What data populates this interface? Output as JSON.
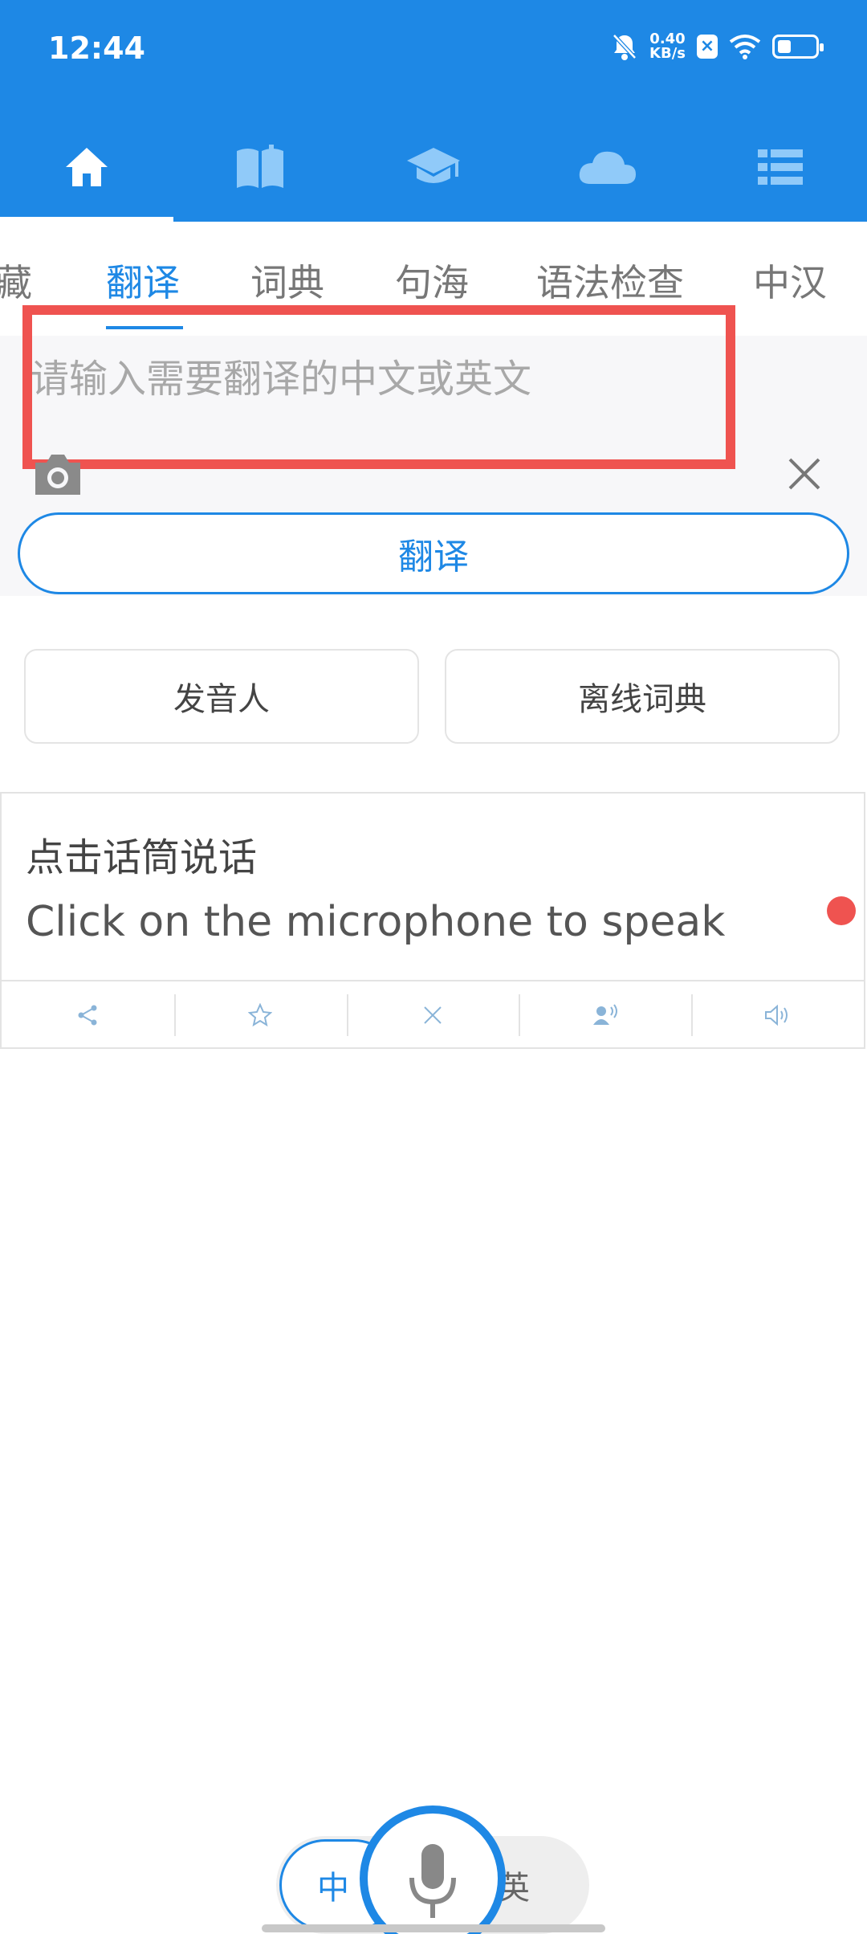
{
  "status_bar": {
    "time": "12:44",
    "speed_value": "0.40",
    "speed_unit": "KB/s"
  },
  "nav_tabs": [
    {
      "icon": "home-icon",
      "active": true
    },
    {
      "icon": "book-icon",
      "active": false
    },
    {
      "icon": "graduation-cap-icon",
      "active": false
    },
    {
      "icon": "cloud-icon",
      "active": false
    },
    {
      "icon": "list-icon",
      "active": false
    }
  ],
  "sub_tabs": [
    "藏",
    "翻译",
    "词典",
    "句海",
    "语法检查",
    "中汉"
  ],
  "active_sub_tab": "翻译",
  "input": {
    "placeholder": "请输入需要翻译的中文或英文",
    "value": ""
  },
  "translate_button": "翻译",
  "options": {
    "speaker_button": "发音人",
    "offline_dict_button": "离线词典"
  },
  "result_card": {
    "source_text": "点击话筒说话",
    "translated_text": "Click on the microphone to speak",
    "actions": [
      "share-icon",
      "star-icon",
      "close-icon",
      "voice-icon",
      "speaker-icon"
    ]
  },
  "language_switch": {
    "from": "中",
    "to": "英"
  },
  "colors": {
    "primary": "#1e88e5",
    "highlight_box": "#ef5350",
    "record_dot": "#ef5350"
  }
}
